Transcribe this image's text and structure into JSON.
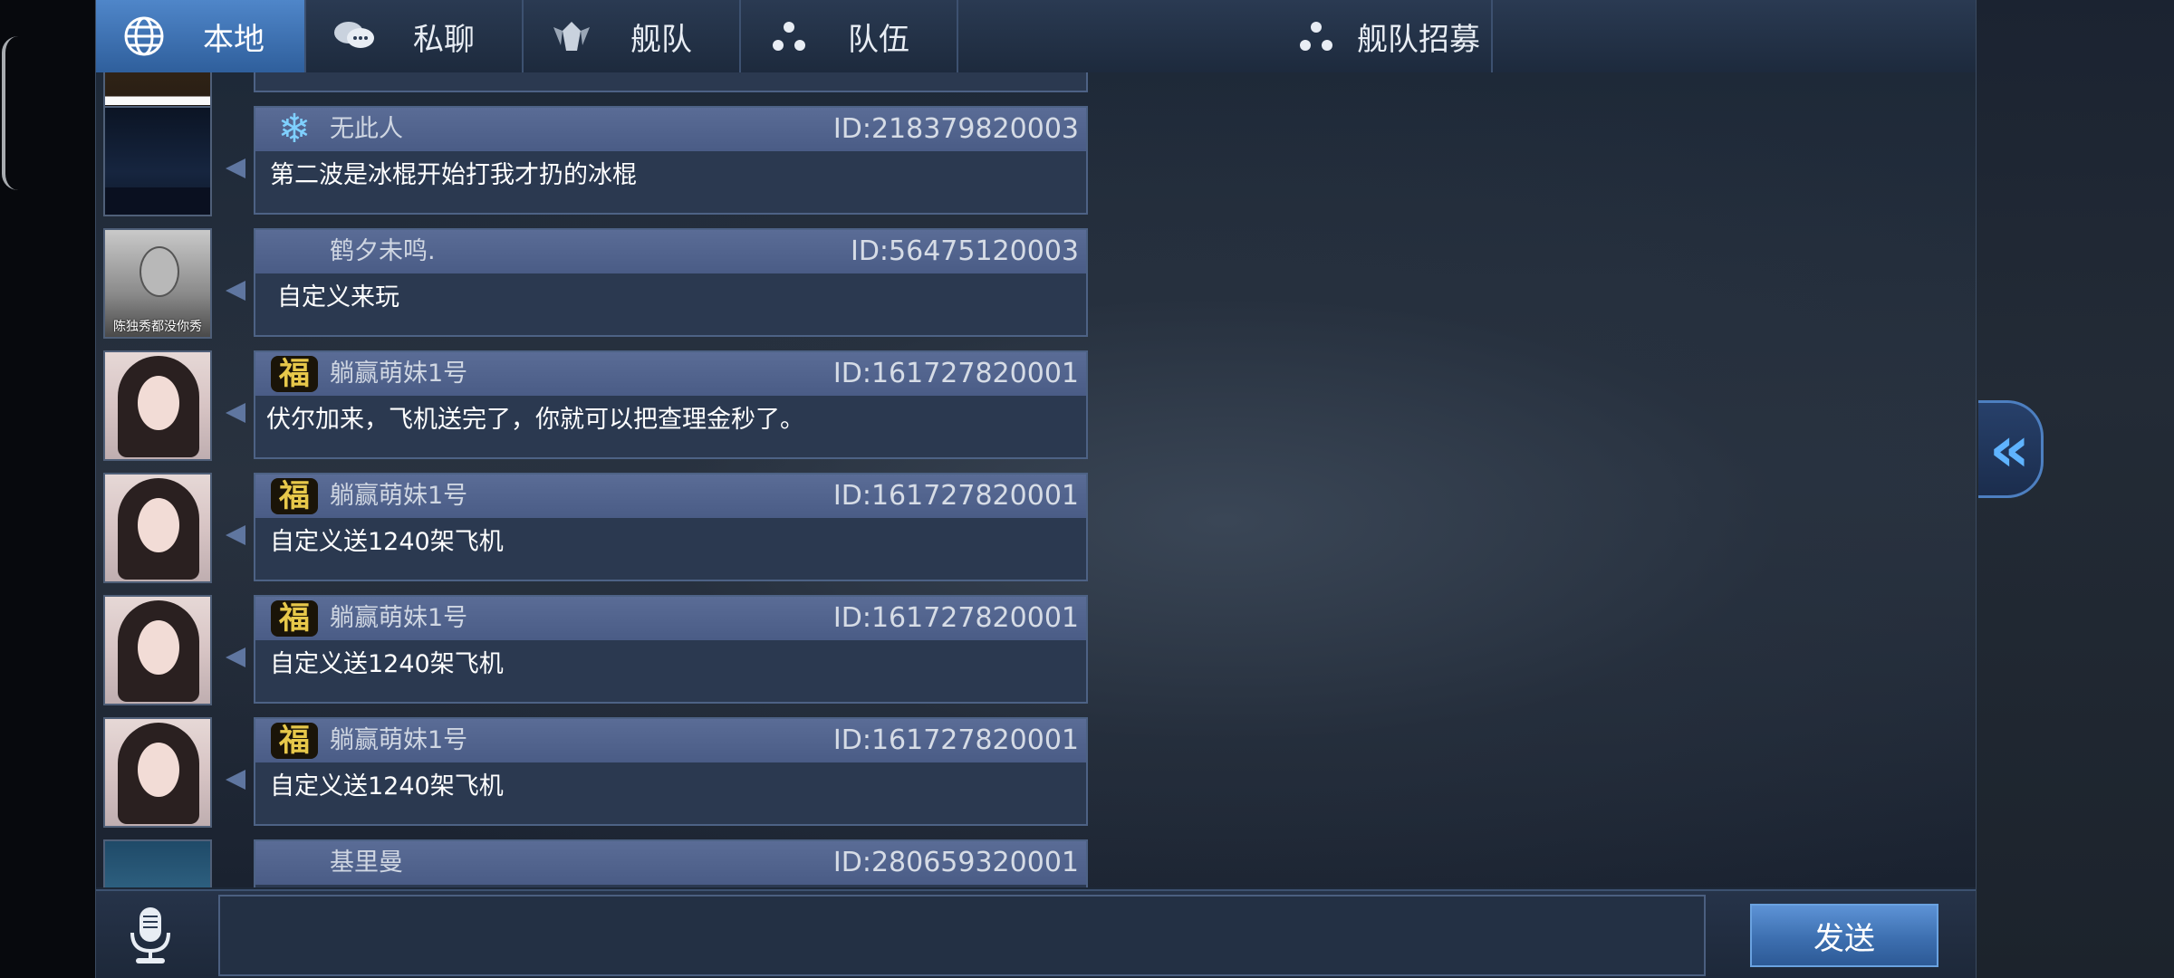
{
  "tabs": [
    {
      "label": "本地",
      "icon": "globe-icon",
      "active": true
    },
    {
      "label": "私聊",
      "icon": "chat-bubbles-icon",
      "active": false
    },
    {
      "label": "舰队",
      "icon": "fleet-emblem-icon",
      "active": false
    },
    {
      "label": "队伍",
      "icon": "team-dots-icon",
      "active": false
    },
    {
      "label": "舰队招募",
      "icon": "team-dots-icon",
      "active": false
    }
  ],
  "messages": [
    {
      "name": "无此人",
      "id": "ID:218379820003",
      "text": "第二波是冰棍开始打我才扔的冰棍",
      "badge": "snowflake-icon"
    },
    {
      "name": "鹤夕未鸣.",
      "id": "ID:56475120003",
      "text": "自定义来玩",
      "avatar_caption": "陈独秀都没你秀"
    },
    {
      "name": "躺赢萌妹1号",
      "id": "ID:161727820001",
      "text": "伏尔加来，飞机送完了，你就可以把查理金秒了。",
      "badge_text": "福"
    },
    {
      "name": "躺赢萌妹1号",
      "id": "ID:161727820001",
      "text": "自定义送1240架飞机",
      "badge_text": "福"
    },
    {
      "name": "躺赢萌妹1号",
      "id": "ID:161727820001",
      "text": "自定义送1240架飞机",
      "badge_text": "福"
    },
    {
      "name": "躺赢萌妹1号",
      "id": "ID:161727820001",
      "text": "自定义送1240架飞机",
      "badge_text": "福"
    },
    {
      "name": "基里曼",
      "id": "ID:280659320001",
      "text": ""
    }
  ],
  "input": {
    "value": "",
    "placeholder": ""
  },
  "send_label": "发送",
  "expand_icon": "double-chevron-left-icon",
  "colors": {
    "accent": "#4f86c9",
    "panel": "#1d2838",
    "bubble_header": "#5a6c96"
  }
}
